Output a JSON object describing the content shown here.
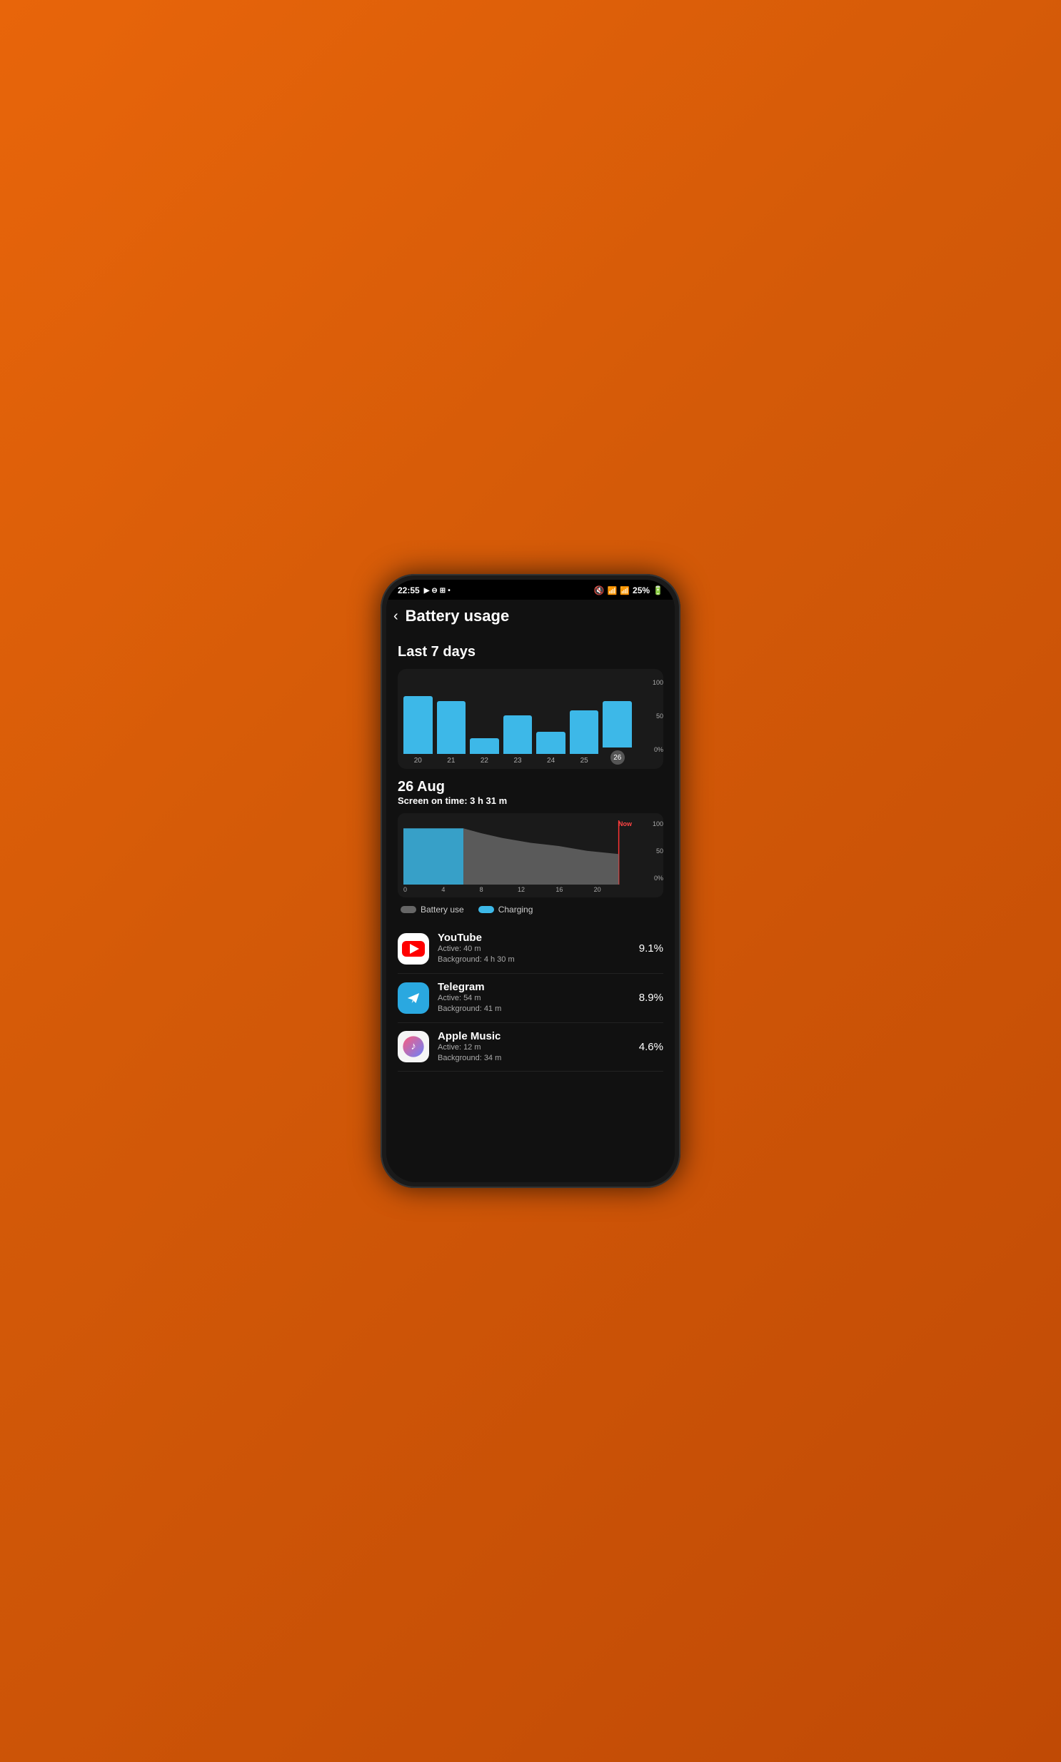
{
  "status": {
    "time": "22:55",
    "battery": "25%",
    "mute_icon": "🔇",
    "wifi_icon": "📶",
    "signal_icon": "📶"
  },
  "header": {
    "back_label": "‹",
    "title": "Battery usage"
  },
  "weekly_chart": {
    "section_title": "Last 7 days",
    "y_labels": [
      "100",
      "50",
      "0%"
    ],
    "bars": [
      {
        "day": "20",
        "height": 90,
        "active": false
      },
      {
        "day": "21",
        "height": 82,
        "active": false
      },
      {
        "day": "22",
        "height": 25,
        "active": false
      },
      {
        "day": "23",
        "height": 60,
        "active": false
      },
      {
        "day": "24",
        "height": 35,
        "active": false
      },
      {
        "day": "25",
        "height": 68,
        "active": false
      },
      {
        "day": "26",
        "height": 72,
        "active": true
      }
    ]
  },
  "daily": {
    "date": "26 Aug",
    "screen_on_time": "Screen on time: 3 h 31 m",
    "now_label": "Now",
    "y_labels": [
      "100",
      "50",
      "0%"
    ],
    "x_labels": [
      "0",
      "4",
      "8",
      "12",
      "16",
      "20"
    ]
  },
  "legend": {
    "battery_use": "Battery use",
    "charging": "Charging"
  },
  "apps": [
    {
      "name": "YouTube",
      "icon_type": "youtube",
      "active": "Active: 40 m",
      "background": "Background: 4 h 30 m",
      "percent": "9.1%"
    },
    {
      "name": "Telegram",
      "icon_type": "telegram",
      "active": "Active: 54 m",
      "background": "Background: 41 m",
      "percent": "8.9%"
    },
    {
      "name": "Apple Music",
      "icon_type": "applemusic",
      "active": "Active: 12 m",
      "background": "Background: 34 m",
      "percent": "4.6%"
    }
  ]
}
